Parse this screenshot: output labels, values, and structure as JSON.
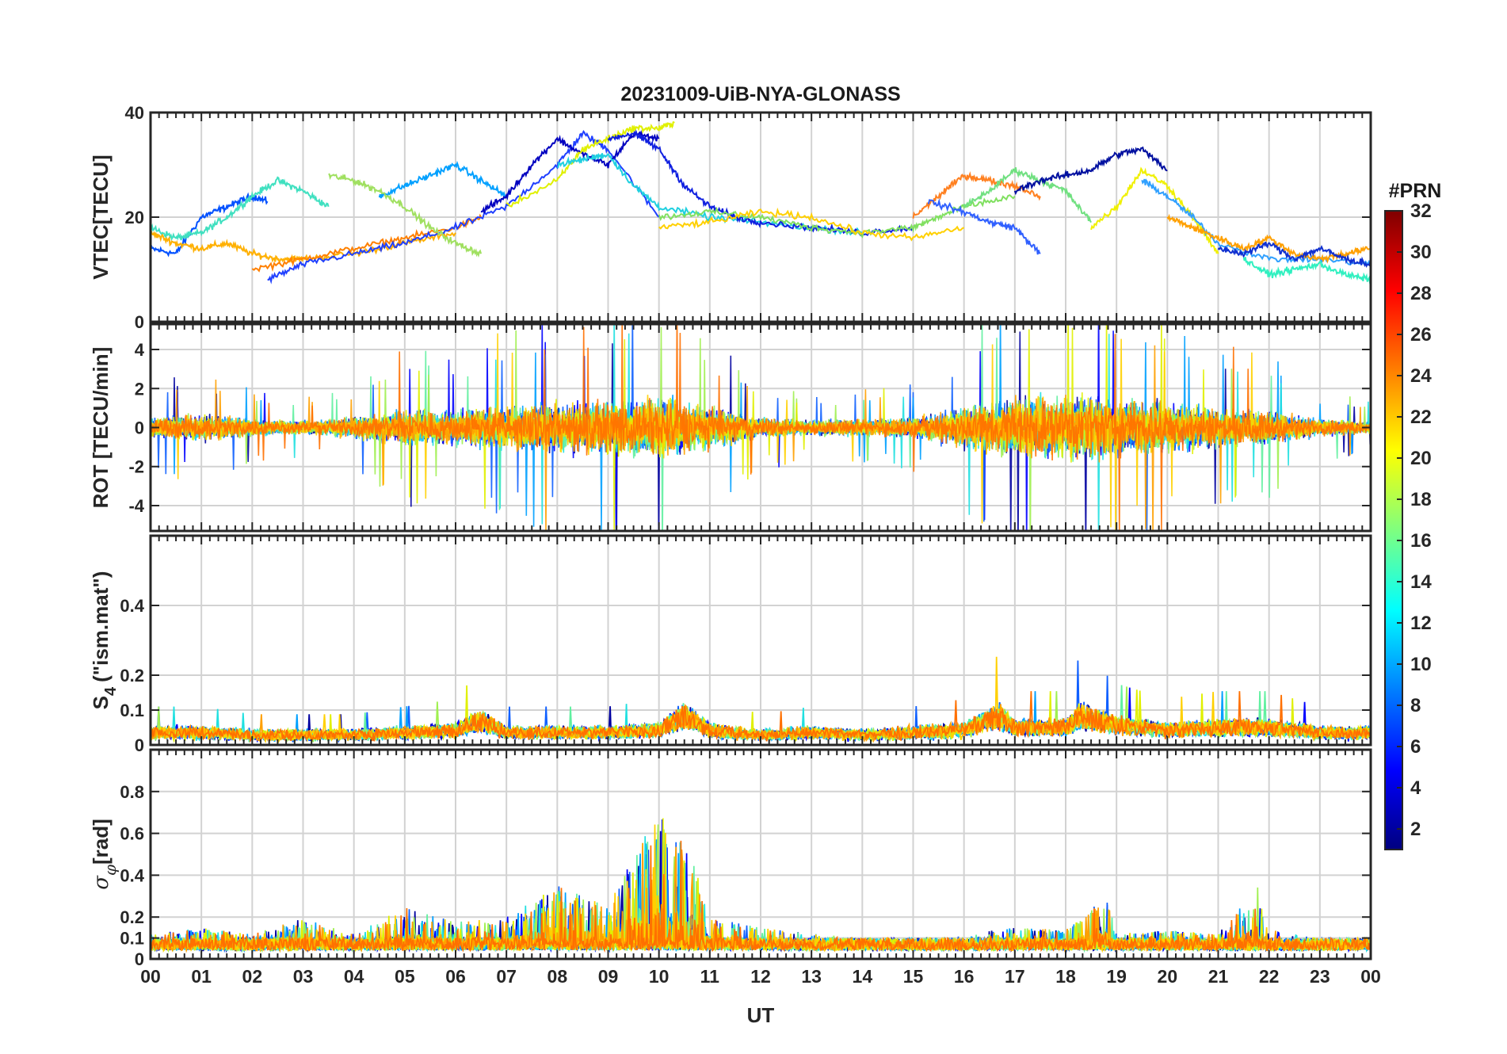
{
  "figure": {
    "title": "20231009-UiB-NYA-GLONASS",
    "xlabel": "UT",
    "x_tick_labels": [
      "00",
      "01",
      "02",
      "03",
      "04",
      "05",
      "06",
      "07",
      "08",
      "09",
      "10",
      "11",
      "12",
      "13",
      "14",
      "15",
      "16",
      "17",
      "18",
      "19",
      "20",
      "21",
      "22",
      "23",
      "00"
    ]
  },
  "colorbar": {
    "label": "#PRN",
    "range": [
      1,
      32
    ],
    "tick_labels": [
      "2",
      "4",
      "6",
      "8",
      "10",
      "12",
      "14",
      "16",
      "18",
      "20",
      "22",
      "24",
      "26",
      "28",
      "30",
      "32"
    ],
    "colormap": "jet",
    "colormap_stops": [
      "#00007f",
      "#0000ff",
      "#007fff",
      "#00ffff",
      "#7fff7f",
      "#ffff00",
      "#ff7f00",
      "#ff0000",
      "#7f0000"
    ]
  },
  "chart_data": [
    {
      "type": "line",
      "panel": "vtec",
      "ylabel": "VTEC[TECU]",
      "ylim": [
        0,
        40
      ],
      "y_ticks": [
        "0",
        "20",
        "40"
      ],
      "x_range_hours": [
        0,
        24
      ],
      "grid": true,
      "series": [
        {
          "color": "#0050ff",
          "x": [
            0,
            0.5,
            1,
            1.5,
            2,
            2.3
          ],
          "y": [
            14,
            13,
            20,
            22,
            24,
            23
          ]
        },
        {
          "color": "#40e0c0",
          "x": [
            0,
            0.5,
            1,
            1.5,
            2,
            2.5,
            3,
            3.5
          ],
          "y": [
            18,
            16,
            17,
            20,
            24,
            27,
            25,
            22
          ]
        },
        {
          "color": "#ffb000",
          "x": [
            0,
            0.5,
            1,
            1.5,
            2,
            2.5,
            3,
            4,
            5,
            6
          ],
          "y": [
            17,
            15,
            14,
            15,
            13,
            12,
            12,
            13,
            15,
            17
          ]
        },
        {
          "color": "#ff8000",
          "x": [
            2,
            3,
            4,
            5,
            6,
            6.5
          ],
          "y": [
            10,
            12,
            14,
            16,
            18,
            20
          ]
        },
        {
          "color": "#2040ff",
          "x": [
            2.3,
            3,
            4,
            5,
            6,
            7,
            8,
            8.5,
            9,
            10
          ],
          "y": [
            8,
            11,
            13,
            15,
            18,
            22,
            30,
            36,
            33,
            20
          ]
        },
        {
          "color": "#00a0ff",
          "x": [
            4.5,
            5,
            5.5,
            6,
            6.5,
            7
          ],
          "y": [
            24,
            26,
            28,
            30,
            27,
            24
          ]
        },
        {
          "color": "#a0e060",
          "x": [
            3.5,
            4,
            4.5,
            5,
            5.5,
            6,
            6.5
          ],
          "y": [
            28,
            27,
            25,
            22,
            18,
            15,
            13
          ]
        },
        {
          "color": "#0000c0",
          "x": [
            6.5,
            7,
            7.5,
            8,
            8.5,
            9,
            9.5,
            10
          ],
          "y": [
            21,
            24,
            30,
            35,
            32,
            30,
            36,
            35
          ]
        },
        {
          "color": "#e0f000",
          "x": [
            7,
            8,
            8.5,
            9,
            9.5,
            10,
            10.3
          ],
          "y": [
            22,
            27,
            33,
            35,
            37,
            37,
            38
          ]
        },
        {
          "color": "#20d0e0",
          "x": [
            8,
            8.5,
            9,
            9.5,
            10,
            11,
            12,
            13,
            14
          ],
          "y": [
            30,
            31,
            32,
            26,
            22,
            20,
            19,
            18,
            17
          ]
        },
        {
          "color": "#1020e0",
          "x": [
            9,
            9.5,
            10,
            10.5,
            11,
            11.5,
            12,
            13,
            14,
            15
          ],
          "y": [
            35,
            36,
            33,
            26,
            22,
            20,
            19,
            18,
            17,
            18
          ]
        },
        {
          "color": "#80e060",
          "x": [
            10,
            11,
            12,
            13,
            14,
            15,
            15.5,
            16,
            17
          ],
          "y": [
            20,
            21,
            20,
            18,
            17,
            18,
            20,
            22,
            24
          ]
        },
        {
          "color": "#ffd000",
          "x": [
            10,
            11,
            12,
            13,
            14,
            15,
            16
          ],
          "y": [
            18,
            19,
            21,
            20,
            17,
            16,
            18
          ]
        },
        {
          "color": "#ff8020",
          "x": [
            15,
            15.5,
            16,
            16.5,
            17,
            17.5
          ],
          "y": [
            20,
            24,
            28,
            27,
            26,
            24
          ]
        },
        {
          "color": "#3060ff",
          "x": [
            15.3,
            16,
            16.5,
            17,
            17.5
          ],
          "y": [
            23,
            21,
            19,
            18,
            13
          ]
        },
        {
          "color": "#70e080",
          "x": [
            16,
            16.5,
            17,
            17.5,
            18,
            18.5
          ],
          "y": [
            22,
            25,
            29,
            27,
            25,
            19
          ]
        },
        {
          "color": "#0010a0",
          "x": [
            17,
            17.5,
            18,
            18.5,
            19,
            19.5,
            20
          ],
          "y": [
            25,
            27,
            28,
            29,
            32,
            33,
            29
          ]
        },
        {
          "color": "#f0f000",
          "x": [
            18.5,
            19,
            19.5,
            20,
            20.5,
            21
          ],
          "y": [
            18,
            22,
            29,
            26,
            20,
            13
          ]
        },
        {
          "color": "#30a0ff",
          "x": [
            19.5,
            20,
            20.5,
            21,
            22,
            23,
            24
          ],
          "y": [
            27,
            24,
            20,
            15,
            12,
            12,
            11
          ]
        },
        {
          "color": "#ffa000",
          "x": [
            20,
            20.5,
            21,
            21.5,
            22,
            22.5,
            23,
            23.5,
            24
          ],
          "y": [
            20,
            18,
            16,
            14,
            16,
            13,
            12,
            13,
            14
          ]
        },
        {
          "color": "#1030d0",
          "x": [
            21,
            21.5,
            22,
            22.5,
            23,
            23.5,
            24
          ],
          "y": [
            14,
            13,
            15,
            12,
            14,
            12,
            11
          ]
        },
        {
          "color": "#30f0c0",
          "x": [
            21.5,
            22,
            22.5,
            23,
            23.5,
            24
          ],
          "y": [
            12,
            9,
            10,
            11,
            9,
            8
          ]
        }
      ]
    },
    {
      "type": "line",
      "panel": "rot",
      "ylabel": "ROT [TECU/min]",
      "ylim": [
        -5.3,
        5.3
      ],
      "y_ticks": [
        "-4",
        "-2",
        "0",
        "2",
        "4"
      ],
      "x_range_hours": [
        0,
        24
      ],
      "grid": true,
      "activity_profile": {
        "hours": [
          0,
          1,
          2,
          3,
          4,
          5,
          6,
          7,
          8,
          9,
          10,
          11,
          12,
          13,
          14,
          15,
          16,
          17,
          18,
          19,
          20,
          21,
          22,
          23,
          24
        ],
        "amplitude": [
          1.2,
          1.6,
          1.0,
          0.8,
          1.2,
          2.2,
          2.0,
          2.6,
          3.0,
          3.0,
          3.8,
          2.4,
          1.2,
          0.9,
          1.0,
          1.2,
          2.4,
          3.6,
          3.8,
          3.4,
          3.0,
          2.2,
          2.0,
          1.0,
          0.7
        ]
      }
    },
    {
      "type": "line",
      "panel": "s4",
      "ylabel": "S4 (\"ism.mat\")",
      "ylim": [
        0,
        0.6
      ],
      "y_ticks": [
        "0",
        "0.1",
        "0.2",
        "0.4"
      ],
      "x_range_hours": [
        0,
        24
      ],
      "grid": true,
      "baseline_profile": {
        "hours": [
          0,
          1,
          2,
          3,
          4,
          5,
          6,
          6.5,
          7,
          8,
          9,
          10,
          10.5,
          11,
          12,
          13,
          14,
          15,
          16,
          16.7,
          17,
          18,
          18.3,
          19,
          20,
          21,
          22,
          23,
          24
        ],
        "level": [
          0.05,
          0.05,
          0.04,
          0.04,
          0.04,
          0.05,
          0.06,
          0.1,
          0.05,
          0.05,
          0.05,
          0.06,
          0.12,
          0.06,
          0.04,
          0.05,
          0.04,
          0.05,
          0.06,
          0.12,
          0.07,
          0.07,
          0.12,
          0.08,
          0.06,
          0.07,
          0.07,
          0.05,
          0.05
        ]
      }
    },
    {
      "type": "line",
      "panel": "sigma_phi",
      "ylabel": "σφ[rad]",
      "ylim": [
        0,
        1.0
      ],
      "y_ticks": [
        "0",
        "0.1",
        "0.2",
        "0.4",
        "0.6",
        "0.8"
      ],
      "x_range_hours": [
        0,
        24
      ],
      "grid": true,
      "peak_profile": {
        "hours": [
          0,
          1,
          2,
          3,
          4,
          5,
          6,
          7,
          8,
          9,
          9.5,
          10,
          10.3,
          10.6,
          11,
          12,
          13,
          14,
          15,
          16,
          17,
          18,
          18.8,
          19,
          20,
          21,
          21.8,
          22,
          23,
          24
        ],
        "level": [
          0.12,
          0.15,
          0.12,
          0.2,
          0.12,
          0.25,
          0.18,
          0.2,
          0.35,
          0.25,
          0.5,
          0.72,
          0.6,
          0.55,
          0.2,
          0.15,
          0.12,
          0.1,
          0.1,
          0.12,
          0.15,
          0.14,
          0.3,
          0.12,
          0.14,
          0.12,
          0.35,
          0.14,
          0.1,
          0.1
        ]
      }
    }
  ]
}
